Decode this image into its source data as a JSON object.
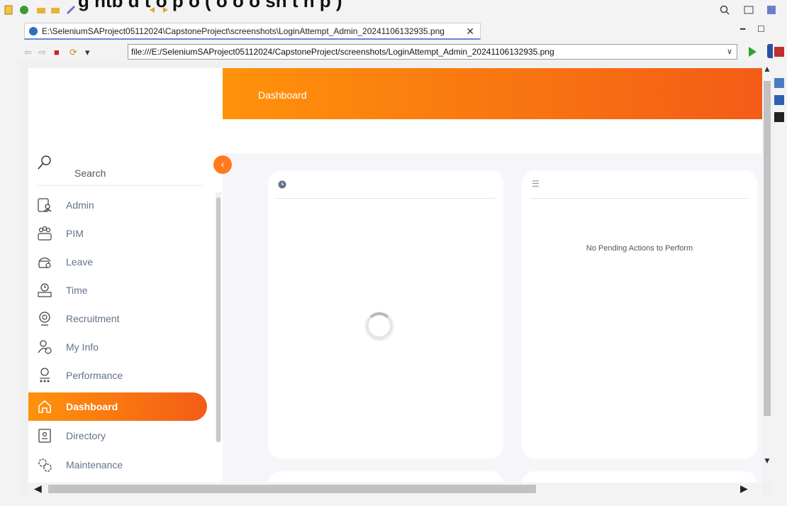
{
  "ide": {
    "headline_fragment": "g  ntb  d  t  o p  o  ( o  o o  sn  t  n  p ) ",
    "icons": [
      "new-file-icon",
      "run-icon",
      "open-folder-icon",
      "pin-icon",
      "back-icon",
      "forward-icon",
      "search-icon",
      "perspective-icon"
    ]
  },
  "browser": {
    "tab_title": "E:\\SeleniumSAProject05112024\\CapstoneProject\\screenshots\\LoginAttempt_Admin_20241106132935.png",
    "tab_close": "✕",
    "url": "file:///E:/SeleniumSAProject05112024/CapstoneProject/screenshots/LoginAttempt_Admin_20241106132935.png",
    "minimize": "━",
    "maximize": "☐"
  },
  "app": {
    "page_title": "Dashboard",
    "collapse_glyph": "‹",
    "search_label": "Search",
    "menu": [
      {
        "label": "Admin",
        "icon": "admin-icon"
      },
      {
        "label": "PIM",
        "icon": "pim-icon"
      },
      {
        "label": "Leave",
        "icon": "leave-icon"
      },
      {
        "label": "Time",
        "icon": "time-icon"
      },
      {
        "label": "Recruitment",
        "icon": "recruitment-icon"
      },
      {
        "label": "My Info",
        "icon": "my-info-icon"
      },
      {
        "label": "Performance",
        "icon": "performance-icon"
      },
      {
        "label": "Dashboard",
        "icon": "dashboard-icon",
        "active": true
      },
      {
        "label": "Directory",
        "icon": "directory-icon"
      },
      {
        "label": "Maintenance",
        "icon": "maintenance-icon"
      }
    ],
    "cards": {
      "time_at_work": {
        "icon": "clock-icon",
        "status": "loading"
      },
      "my_actions": {
        "icon": "list-icon",
        "message": "No Pending Actions to Perform"
      }
    },
    "colors": {
      "accent_start": "#ff920b",
      "accent_end": "#f35c17",
      "menu_text": "#64728c"
    }
  }
}
